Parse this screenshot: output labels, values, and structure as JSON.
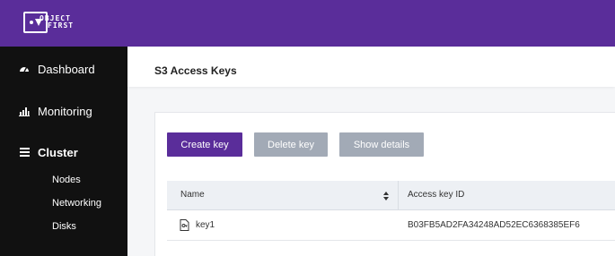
{
  "logo": {
    "line1": "OBJECT",
    "line2": "FIRST"
  },
  "colors": {
    "brand": "#5a2d9a",
    "sidebar": "#111111",
    "button_disabled": "#a2aab6"
  },
  "sidebar": {
    "items": [
      {
        "label": "Dashboard",
        "icon": "gauge-icon"
      },
      {
        "label": "Monitoring",
        "icon": "bar-chart-icon"
      },
      {
        "label": "Cluster",
        "icon": "list-icon"
      }
    ],
    "cluster_subitems": [
      "Nodes",
      "Networking",
      "Disks"
    ]
  },
  "page": {
    "title": "S3 Access Keys"
  },
  "toolbar": {
    "create_label": "Create key",
    "delete_label": "Delete key",
    "show_label": "Show details"
  },
  "table": {
    "columns": [
      "Name",
      "Access key ID"
    ],
    "rows": [
      {
        "name": "key1",
        "access_key_id": "B03FB5AD2FA34248AD52EC6368385EF6"
      }
    ]
  }
}
